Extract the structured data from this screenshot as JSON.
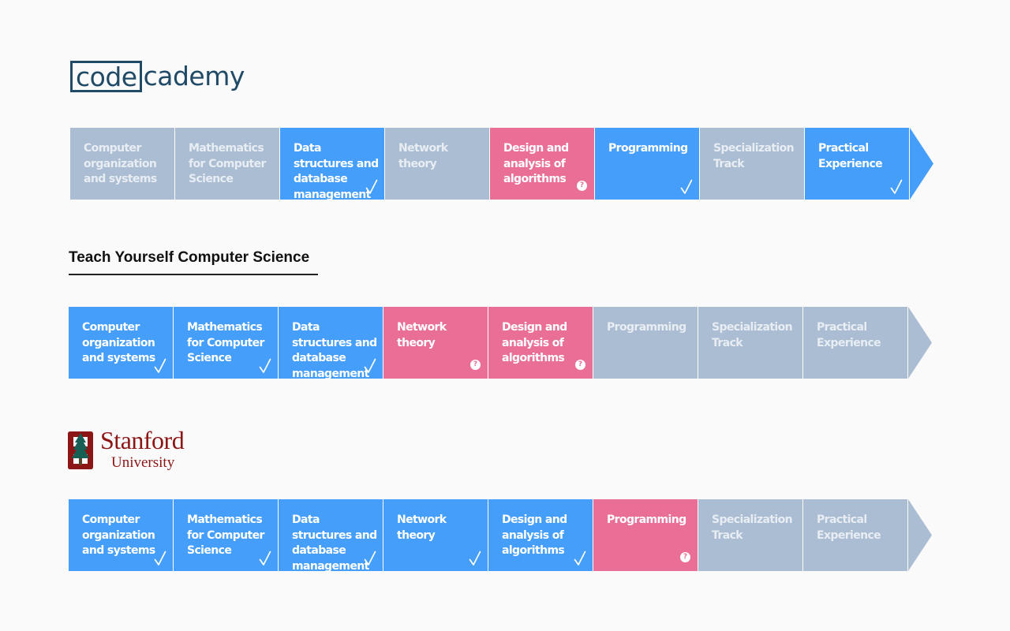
{
  "codecademy": {
    "logo_box_text": "code",
    "logo_rest_text": "cademy",
    "steps": [
      {
        "label": "Computer organization and systems",
        "status": "gray",
        "mark": ""
      },
      {
        "label": "Mathematics for Computer Science",
        "status": "gray",
        "mark": ""
      },
      {
        "label": "Data structures and database management",
        "status": "blue",
        "mark": "check"
      },
      {
        "label": "Network theory",
        "status": "gray",
        "mark": ""
      },
      {
        "label": "Design and analysis of algorithms",
        "status": "pink",
        "mark": "question"
      },
      {
        "label": "Programming",
        "status": "blue",
        "mark": "check"
      },
      {
        "label": "Specialization Track",
        "status": "gray",
        "mark": ""
      },
      {
        "label": "Practical Experience",
        "status": "blue",
        "mark": "check"
      }
    ]
  },
  "teach_yourself": {
    "title": "Teach Yourself Computer Science",
    "steps": [
      {
        "label": "Computer organization and systems",
        "status": "blue",
        "mark": "check"
      },
      {
        "label": "Mathematics for Computer Science",
        "status": "blue",
        "mark": "check"
      },
      {
        "label": "Data structures and database management",
        "status": "blue",
        "mark": "check"
      },
      {
        "label": "Network theory",
        "status": "pink",
        "mark": "question"
      },
      {
        "label": "Design and analysis of algorithms",
        "status": "pink",
        "mark": "question"
      },
      {
        "label": "Programming",
        "status": "gray",
        "mark": ""
      },
      {
        "label": "Specialization Track",
        "status": "gray",
        "mark": ""
      },
      {
        "label": "Practical Experience",
        "status": "gray",
        "mark": ""
      }
    ]
  },
  "stanford": {
    "name": "Stanford",
    "university": "University",
    "steps": [
      {
        "label": "Computer organization and systems",
        "status": "blue",
        "mark": "check"
      },
      {
        "label": "Mathematics for Computer Science",
        "status": "blue",
        "mark": "check"
      },
      {
        "label": "Data structures and database management",
        "status": "blue",
        "mark": "check"
      },
      {
        "label": "Network theory",
        "status": "blue",
        "mark": "check"
      },
      {
        "label": "Design and analysis of algorithms",
        "status": "blue",
        "mark": "check"
      },
      {
        "label": "Programming",
        "status": "pink",
        "mark": "question"
      },
      {
        "label": "Specialization Track",
        "status": "gray",
        "mark": ""
      },
      {
        "label": "Practical Experience",
        "status": "gray",
        "mark": ""
      }
    ]
  },
  "icons": {
    "check": "checkmark-icon",
    "question": "question-mark-icon",
    "arrow": "arrow-tip-icon"
  },
  "question_glyph": "?",
  "colors": {
    "gray": "#aabdd2",
    "blue": "#459efa",
    "pink": "#e96f96",
    "codecademy": "#204a65",
    "stanford": "#8c1515"
  }
}
